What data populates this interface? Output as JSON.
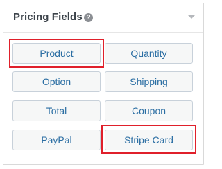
{
  "panel": {
    "title": "Pricing Fields",
    "help_icon": "question-circle-icon",
    "collapse_icon": "caret-down-icon"
  },
  "fields": {
    "product": "Product",
    "quantity": "Quantity",
    "option": "Option",
    "shipping": "Shipping",
    "total": "Total",
    "coupon": "Coupon",
    "paypal": "PayPal",
    "stripe_card": "Stripe Card"
  },
  "colors": {
    "button_text": "#2b6ea3",
    "highlight": "#e0202b"
  }
}
